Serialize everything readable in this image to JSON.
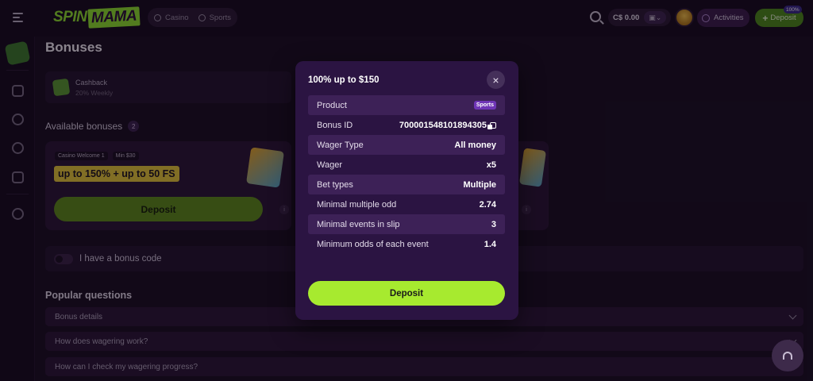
{
  "header": {
    "logo_spin": "SPIN",
    "logo_mama": "MAMA",
    "nav": [
      {
        "label": "Casino"
      },
      {
        "label": "Sports"
      }
    ],
    "balance": "C$ 0.00",
    "activities_label": "Activities",
    "deposit_label": "Deposit",
    "deposit_badge": "100%"
  },
  "main": {
    "title": "Bonuses",
    "cashback": {
      "title": "Cashback",
      "subtitle": "20% Weekly"
    },
    "available_label": "Available bonuses",
    "available_count": "2",
    "card": {
      "tag_name": "Casino Welcome 1",
      "tag_min": "Min $30",
      "amount": "up to 150% + up to 50 FS",
      "deposit_label": "Deposit",
      "info": "i"
    },
    "bonus_code_label": "I have a bonus code",
    "faq_title": "Popular questions",
    "faq": [
      {
        "q": "Bonus details"
      },
      {
        "q": "How does wagering work?"
      },
      {
        "q": "How can I check my wagering progress?"
      }
    ]
  },
  "modal": {
    "title": "100% up to $150",
    "close": "×",
    "rows": [
      {
        "label": "Product",
        "value": "Sports"
      },
      {
        "label": "Bonus ID",
        "value": "700001548101894305"
      },
      {
        "label": "Wager Type",
        "value": "All money"
      },
      {
        "label": "Wager",
        "value": "x5"
      },
      {
        "label": "Bet types",
        "value": "Multiple"
      },
      {
        "label": "Minimal multiple odd",
        "value": "2.74"
      },
      {
        "label": "Minimal events in slip",
        "value": "3"
      },
      {
        "label": "Minimum odds of each event",
        "value": "1.4"
      }
    ],
    "deposit_label": "Deposit"
  }
}
